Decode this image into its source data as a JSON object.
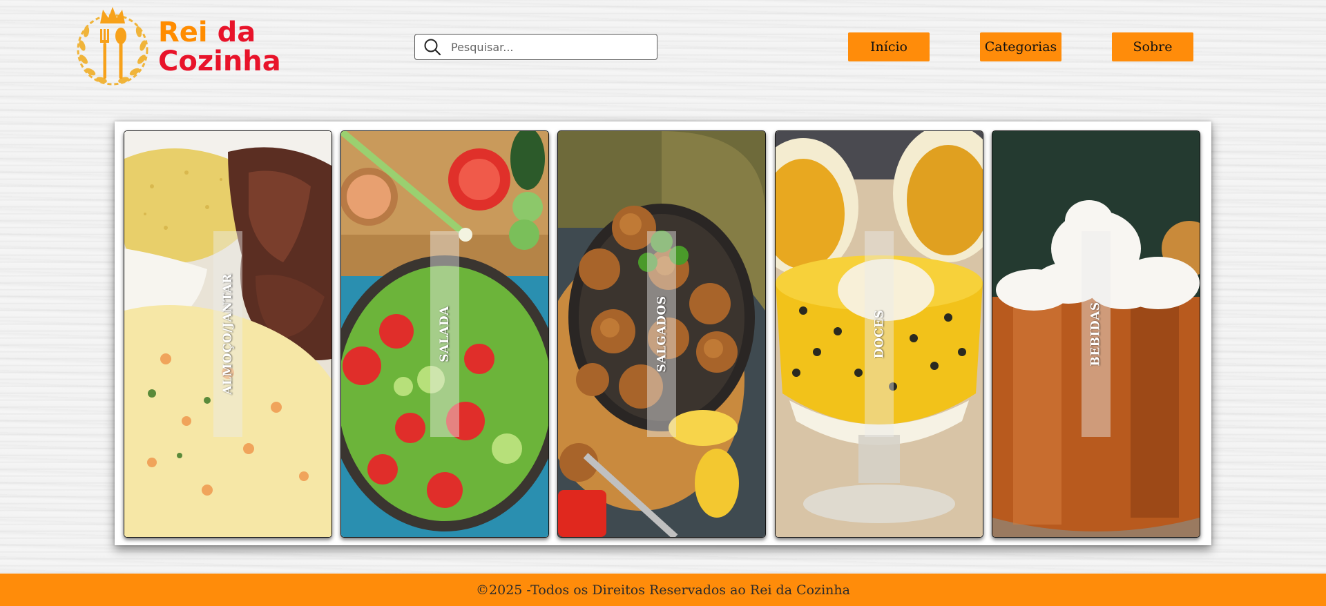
{
  "header": {
    "logo": {
      "line1_word1": "Rei",
      "line1_word2": "da",
      "line2": "Cozinha",
      "icon": "crown-cutlery-laurel-logo"
    },
    "search": {
      "placeholder": "Pesquisar...",
      "value": "",
      "icon": "search-icon"
    },
    "nav": {
      "inicio": "Início",
      "categorias": "Categorias",
      "sobre": "Sobre"
    }
  },
  "categories": [
    {
      "label": "ALMOÇO/JANTAR",
      "image": "roast-beef-rice-farofa-potato-salad"
    },
    {
      "label": "SALADA",
      "image": "green-salad-with-tomatoes"
    },
    {
      "label": "SALGADOS",
      "image": "fried-croquettes-with-lemon"
    },
    {
      "label": "DOCES",
      "image": "passion-fruit-mousse-cup"
    },
    {
      "label": "BEBIDAS",
      "image": "copper-mug-with-whipped-cream"
    }
  ],
  "footer": {
    "text": "©2025 -Todos os Direitos Reservados ao Rei da Cozinha"
  },
  "colors": {
    "accent_orange": "#ff8c0a",
    "logo_red": "#e8132a",
    "logo_orange": "#ff8c00",
    "footer_bg": "#ff8c0a"
  }
}
